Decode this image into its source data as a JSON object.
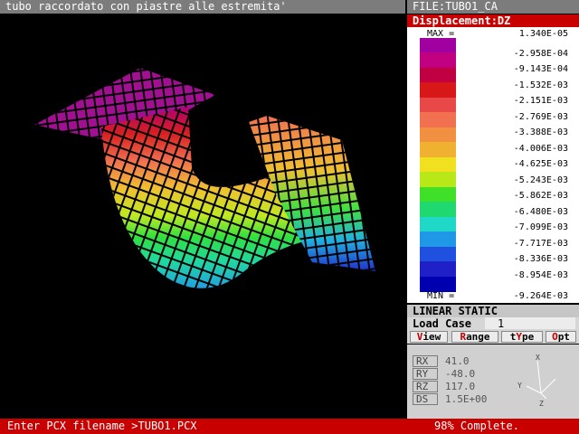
{
  "window": {
    "title": "tubo raccordato con piastre alle estremita'",
    "file": "FILE:TUBO1_CA"
  },
  "result": {
    "label": "Displacement:DZ"
  },
  "legend": {
    "max_label": "MAX =",
    "min_label": "MIN =",
    "max_value": "1.340E-05",
    "min_value": "-9.264E-03",
    "values": [
      "-2.958E-04",
      "-9.143E-04",
      "-1.532E-03",
      "-2.151E-03",
      "-2.769E-03",
      "-3.388E-03",
      "-4.006E-03",
      "-4.625E-03",
      "-5.243E-03",
      "-5.862E-03",
      "-6.480E-03",
      "-7.099E-03",
      "-7.717E-03",
      "-8.336E-03",
      "-8.954E-03"
    ],
    "colors": [
      "#a000a0",
      "#c00080",
      "#c00040",
      "#d81818",
      "#e84848",
      "#f07050",
      "#f09040",
      "#f0b030",
      "#f0e020",
      "#b8e818",
      "#40e028",
      "#20d870",
      "#20d8c8",
      "#2098e8",
      "#2050e0",
      "#2020c8",
      "#0000b0"
    ]
  },
  "analysis": {
    "type": "LINEAR STATIC",
    "load_case_label": "Load Case",
    "load_case_value": "1"
  },
  "menu": [
    {
      "hot": "V",
      "rest": "iew"
    },
    {
      "hot": "R",
      "rest": "ange"
    },
    {
      "pre": "t",
      "hot": "Y",
      "rest": "pe"
    },
    {
      "hot": "O",
      "rest": "pt"
    }
  ],
  "rotation": {
    "rx_label": "RX",
    "rx_value": "41.0",
    "ry_label": "RY",
    "ry_value": "-48.0",
    "rz_label": "RZ",
    "rz_value": "117.0",
    "ds_label": "DS",
    "ds_value": "1.5E+00"
  },
  "axes": {
    "x": "X",
    "y": "Y",
    "z": "Z"
  },
  "status": {
    "prompt": "Enter PCX filename >TUBO1.PCX",
    "progress_text": "98% Complete.",
    "progress_fraction": 0.98
  }
}
